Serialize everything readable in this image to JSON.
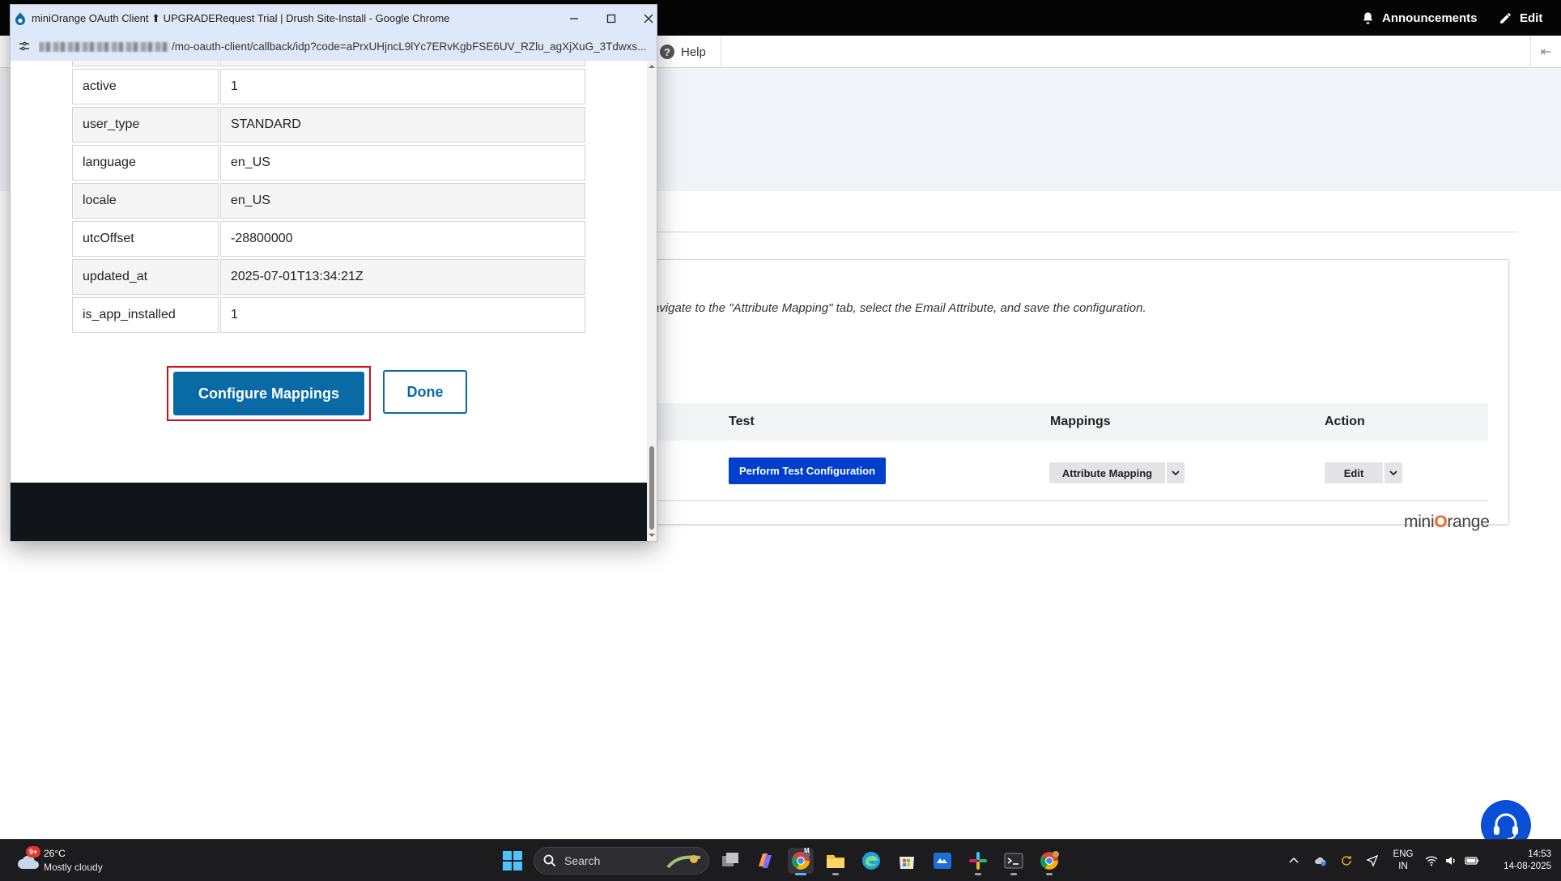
{
  "background_page": {
    "topbar": {
      "announcements_label": "Announcements",
      "edit_label": "Edit"
    },
    "toolbar": {
      "help_label": "Help"
    },
    "notice_text": "avigate to the \"Attribute Mapping\" tab, select the Email Attribute, and save the configuration.",
    "table": {
      "headers": {
        "test": "Test",
        "mappings": "Mappings",
        "action": "Action"
      },
      "row": {
        "test_button": "Perform Test Configuration",
        "mapping_button": "Attribute Mapping",
        "action_button": "Edit"
      }
    },
    "logo": {
      "prefix": "mini",
      "o": "O",
      "suffix": "range"
    },
    "colors": {
      "primary_blue": "#003ecc",
      "page_header_bg": "#f3f4f9",
      "top_bar": "#050505"
    }
  },
  "popup": {
    "window_title": "miniOrange OAuth Client ⬆ UPGRADERequest Trial | Drush Site-Install - Google Chrome",
    "url_visible": "/mo-oauth-client/callback/idp?code=aPrxUHjncL9lYc7ERvKgbFSE6UV_RZlu_agXjXuG_3Tdwxs...",
    "attributes": [
      {
        "key": "",
        "value": ""
      },
      {
        "key": "active",
        "value": "1"
      },
      {
        "key": "user_type",
        "value": "STANDARD"
      },
      {
        "key": "language",
        "value": "en_US"
      },
      {
        "key": "locale",
        "value": "en_US"
      },
      {
        "key": "utcOffset",
        "value": "-28800000"
      },
      {
        "key": "updated_at",
        "value": "2025-07-01T13:34:21Z"
      },
      {
        "key": "is_app_installed",
        "value": "1"
      }
    ],
    "configure_button": "Configure Mappings",
    "done_button": "Done",
    "colors": {
      "button_blue": "#0a6aa6",
      "highlight_red": "#d00e16",
      "titlebar": "#dfe8f9"
    }
  },
  "taskbar": {
    "weather": {
      "badge": "9+",
      "temperature": "26°C",
      "condition": "Mostly cloudy"
    },
    "search_placeholder": "Search",
    "chrome_badge": "M",
    "language": {
      "line1": "ENG",
      "line2": "IN"
    },
    "clock": {
      "time": "14:53",
      "date": "14-08-2025"
    }
  }
}
